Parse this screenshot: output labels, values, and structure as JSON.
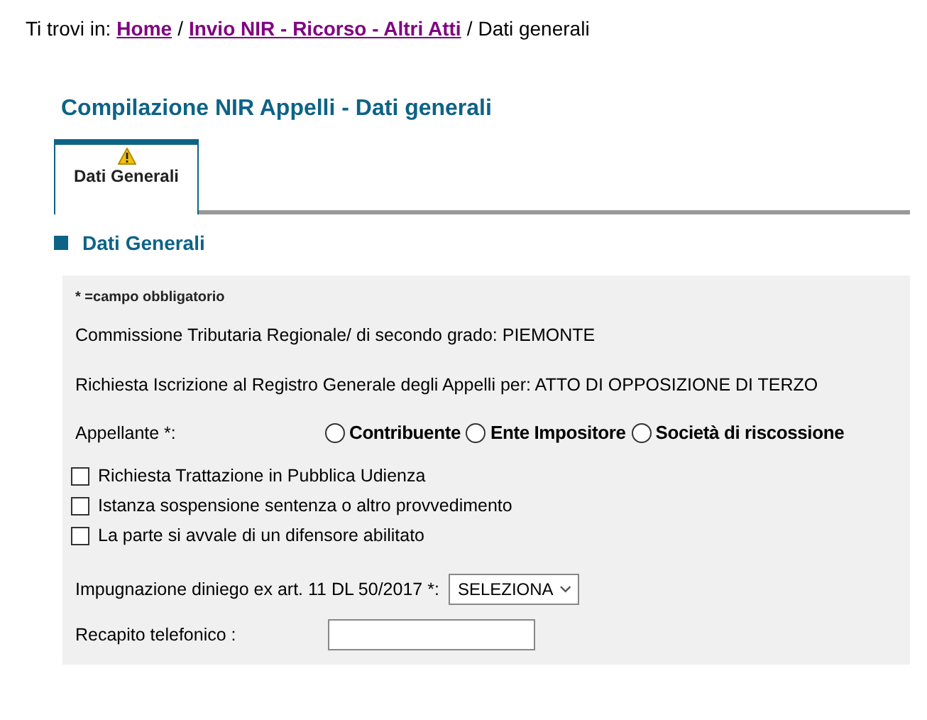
{
  "breadcrumb": {
    "prefix": "Ti trovi in:",
    "links": [
      "Home",
      "Invio NIR - Ricorso - Altri Atti"
    ],
    "current": "Dati generali",
    "separator": "/"
  },
  "page_title": "Compilazione NIR Appelli - Dati generali",
  "tabs": [
    {
      "label": "Dati Generali",
      "selected": true,
      "warning": true
    }
  ],
  "section_title": "Dati Generali",
  "form": {
    "required_note": "* =campo obbligatorio",
    "info_lines": [
      "Commissione Tributaria Regionale/ di secondo grado: PIEMONTE",
      "Richiesta Iscrizione al Registro Generale degli Appelli per: ATTO DI OPPOSIZIONE DI TERZO"
    ],
    "appellant": {
      "label": "Appellante *:",
      "options": [
        {
          "label": "Contribuente",
          "selected": false
        },
        {
          "label": "Ente Impositore",
          "selected": false
        },
        {
          "label": "Società di riscossione",
          "selected": false
        }
      ]
    },
    "checkboxes": [
      {
        "label": "Richiesta Trattazione in Pubblica Udienza",
        "checked": false
      },
      {
        "label": "Istanza sospensione sentenza o altro provvedimento",
        "checked": false
      },
      {
        "label": "La parte si avvale di un difensore abilitato",
        "checked": false
      }
    ],
    "appeal_select": {
      "label": "Impugnazione diniego ex art. 11 DL 50/2017 *:",
      "value": "SELEZIONA"
    },
    "phone": {
      "label": "Recapito telefonico  :"
    }
  }
}
